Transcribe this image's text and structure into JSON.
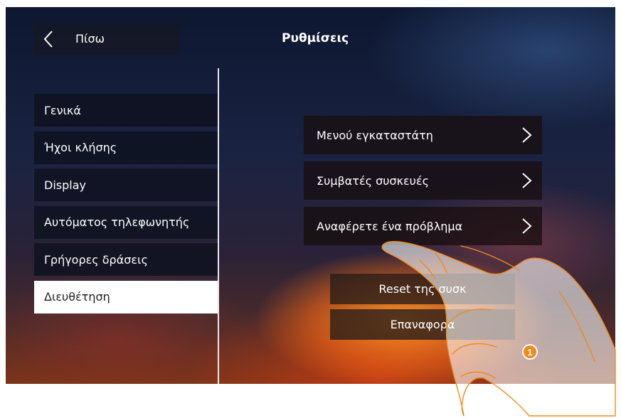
{
  "header": {
    "back_label": "Πίσω",
    "title": "Ρυθμίσεις"
  },
  "sidebar": {
    "items": [
      {
        "label": "Γενικά",
        "active": false
      },
      {
        "label": "Ήχοι κλήσης",
        "active": false
      },
      {
        "label": "Display",
        "active": false
      },
      {
        "label": "Αυτόματος τηλεφωνητής",
        "active": false
      },
      {
        "label": "Γρήγορες δράσεις",
        "active": false
      },
      {
        "label": "Διευθέτηση",
        "active": true
      }
    ]
  },
  "main": {
    "options": [
      {
        "label": "Μενού εγκαταστάτη",
        "icon": "chevron-right-icon"
      },
      {
        "label": "Συμβατές συσκευές",
        "icon": "chevron-right-icon"
      },
      {
        "label": "Αναφέρετε ένα πρόβλημα",
        "icon": "chevron-right-icon"
      }
    ],
    "actions": {
      "reset_label": "Reset της συσκ",
      "restore_label": "Επαναφορά"
    }
  },
  "callout": {
    "number": "1",
    "color": "#f08a1c"
  },
  "colors": {
    "active_item_bg": "#ffffff",
    "item_bg": "#0e1220",
    "hand_outline": "#f08a1c"
  }
}
